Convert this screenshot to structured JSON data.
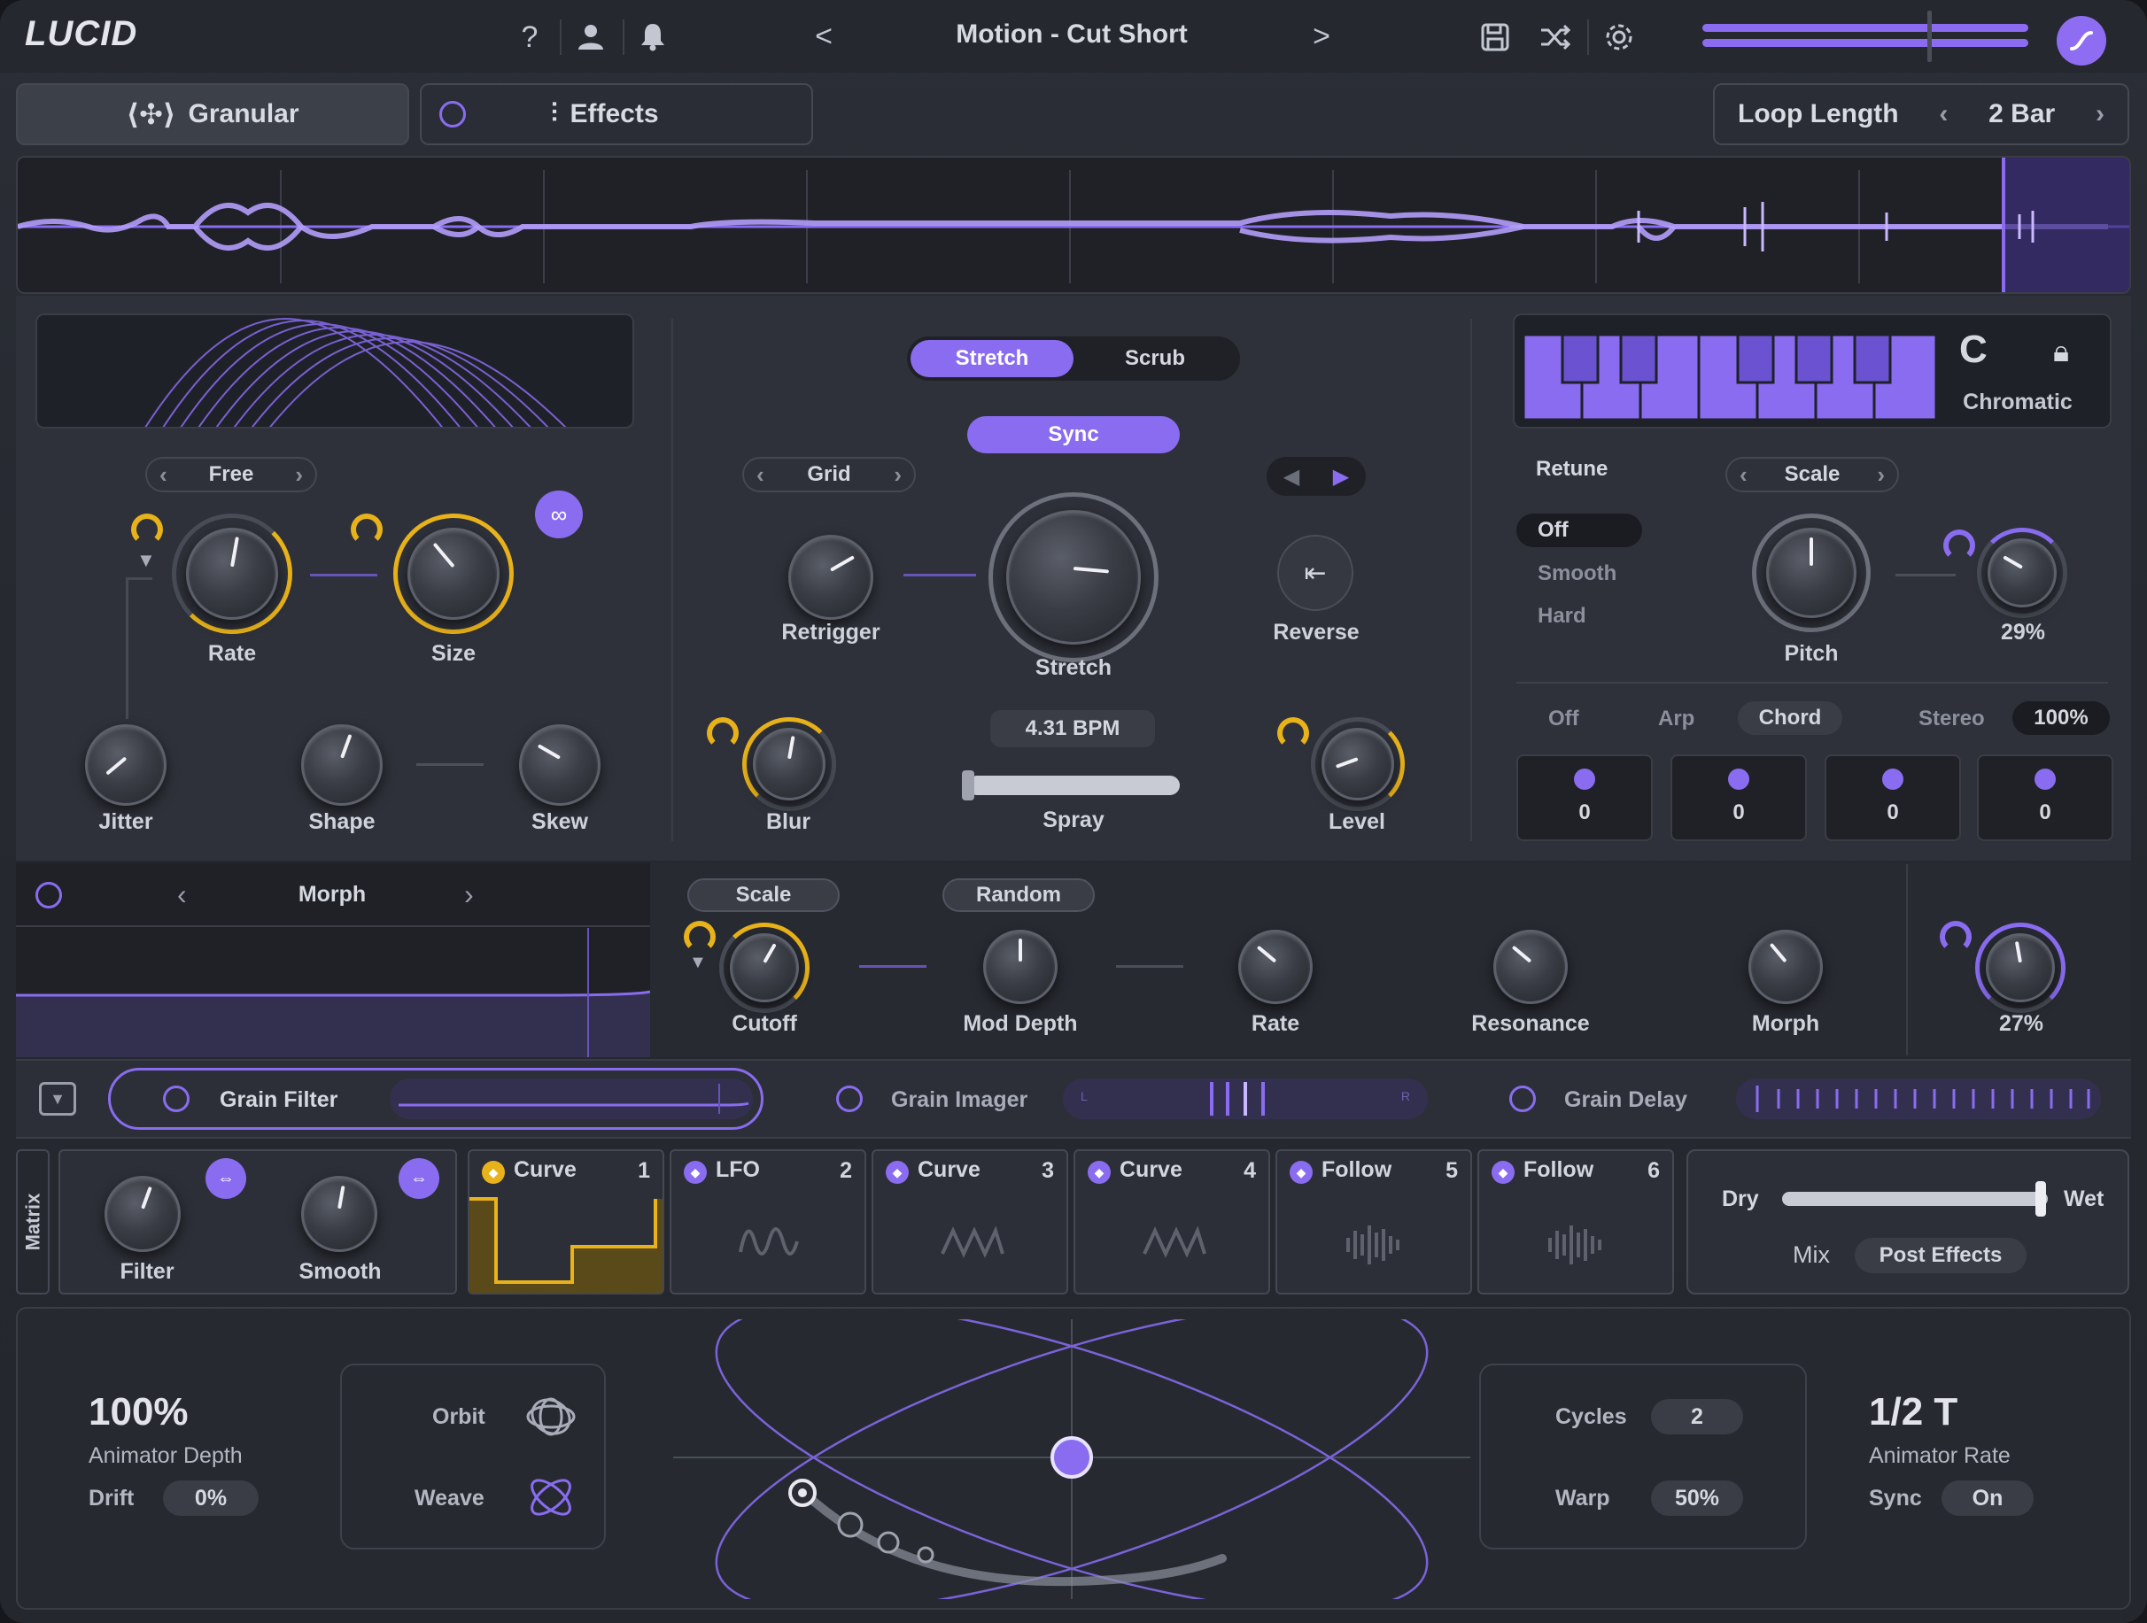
{
  "app": {
    "logo": "LUCID",
    "preset": "Motion - Cut Short",
    "accent": "#8a6cf0",
    "mod_color": "#e8b21a"
  },
  "topbar": {
    "help_icon": "?",
    "prev": "<",
    "next": ">"
  },
  "tabs": {
    "granular": "Granular",
    "effects": "Effects"
  },
  "loop": {
    "label": "Loop Length",
    "value": "2 Bar"
  },
  "granular": {
    "mode": "Free",
    "rate_label": "Rate",
    "size_label": "Size",
    "jitter_label": "Jitter",
    "shape_label": "Shape",
    "skew_label": "Skew"
  },
  "stretch": {
    "seg": [
      "Stretch",
      "Scrub"
    ],
    "sync": "Sync",
    "grid": "Grid",
    "retrigger_label": "Retrigger",
    "stretch_label": "Stretch",
    "reverse_label": "Reverse",
    "bpm": "4.31 BPM",
    "spray_label": "Spray",
    "blur_label": "Blur",
    "level_label": "Level",
    "spray_value": 0.0
  },
  "pitch": {
    "key": "C",
    "scale_name": "Chromatic",
    "retune_label": "Retune",
    "scale_sel": "Scale",
    "retune_opts": [
      "Off",
      "Smooth",
      "Hard"
    ],
    "pitch_label": "Pitch",
    "amount": "29%",
    "modes": [
      "Off",
      "Arp",
      "Chord"
    ],
    "stereo_label": "Stereo",
    "stereo_value": "100%",
    "voices": [
      "0",
      "0",
      "0",
      "0"
    ]
  },
  "filter": {
    "type": "Morph",
    "scale_btn": "Scale",
    "random_btn": "Random",
    "cutoff": "Cutoff",
    "mod_depth": "Mod Depth",
    "rate": "Rate",
    "resonance": "Resonance",
    "morph": "Morph",
    "amount": "27%"
  },
  "fx": {
    "grain_filter": "Grain Filter",
    "grain_imager": "Grain Imager",
    "grain_delay": "Grain Delay",
    "imager_l": "L",
    "imager_r": "R"
  },
  "matrix": {
    "label": "Matrix",
    "filter": "Filter",
    "smooth": "Smooth",
    "slots": [
      {
        "name": "Curve",
        "num": "1"
      },
      {
        "name": "LFO",
        "num": "2"
      },
      {
        "name": "Curve",
        "num": "3"
      },
      {
        "name": "Curve",
        "num": "4"
      },
      {
        "name": "Follow",
        "num": "5"
      },
      {
        "name": "Follow",
        "num": "6"
      }
    ],
    "dry": "Dry",
    "wet": "Wet",
    "mix": "Mix",
    "post": "Post Effects"
  },
  "animator": {
    "depth_value": "100%",
    "depth_label": "Animator Depth",
    "drift_label": "Drift",
    "drift_value": "0%",
    "orbit": "Orbit",
    "weave": "Weave",
    "cycles_label": "Cycles",
    "cycles_value": "2",
    "warp_label": "Warp",
    "warp_value": "50%",
    "rate_value": "1/2 T",
    "rate_label": "Animator Rate",
    "sync_label": "Sync",
    "sync_value": "On"
  }
}
